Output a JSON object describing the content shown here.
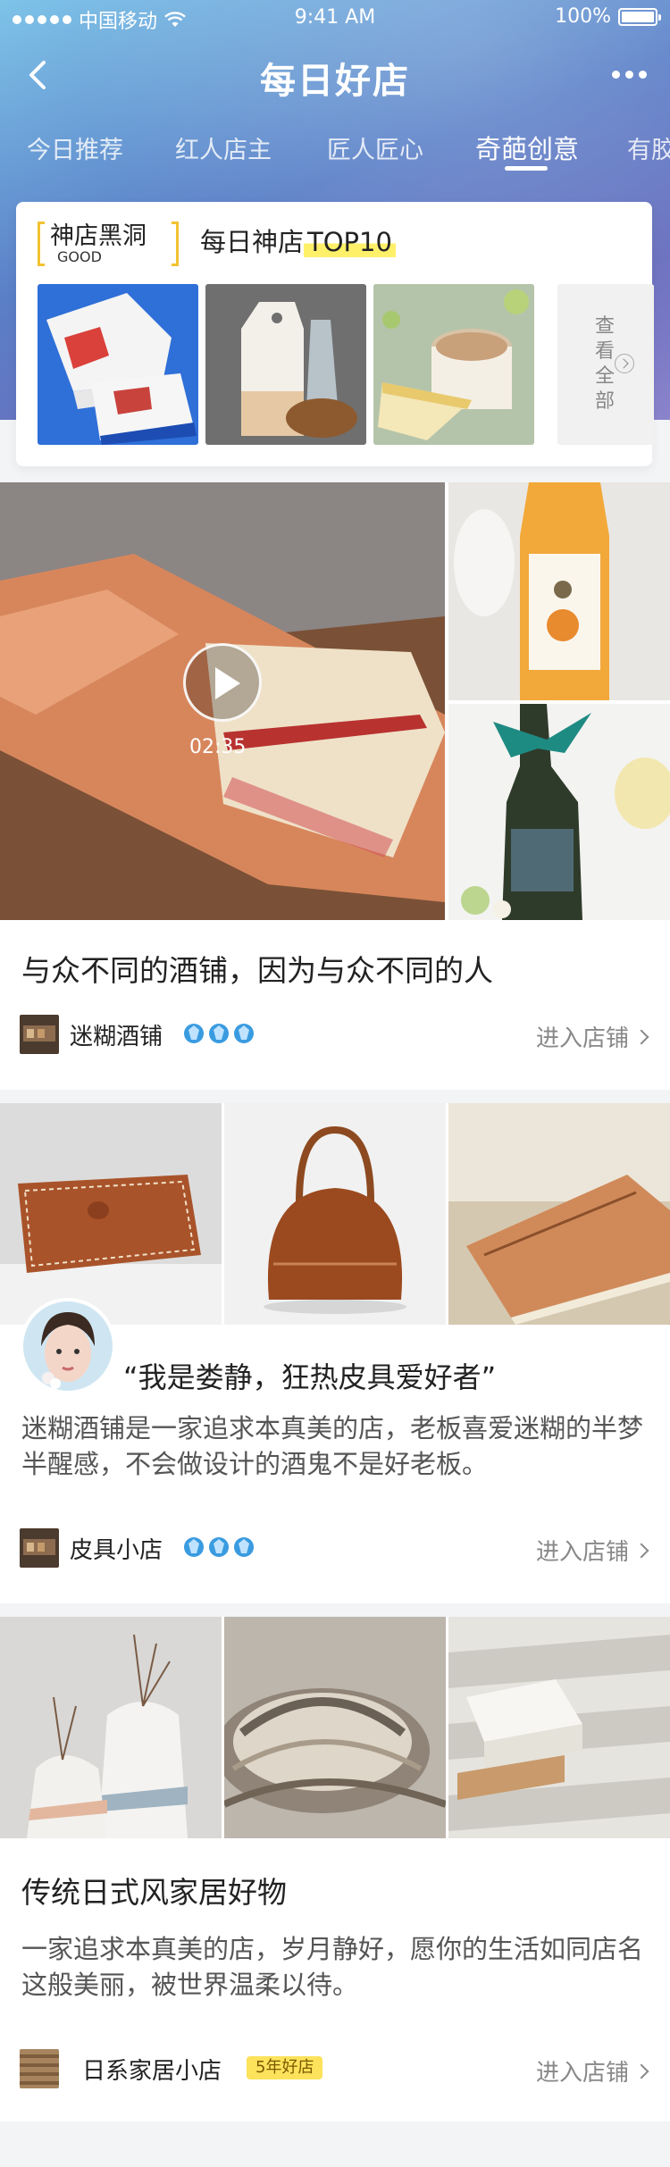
{
  "status_bar": {
    "carrier": "中国移动",
    "time": "9:41 AM",
    "battery": "100%"
  },
  "nav": {
    "title": "每日好店"
  },
  "tabs": [
    {
      "label": "今日推荐"
    },
    {
      "label": "红人店主"
    },
    {
      "label": "匠人匠心"
    },
    {
      "label": "奇葩创意",
      "active": true
    },
    {
      "label": "有胶"
    }
  ],
  "top_card": {
    "brand_cn": "神店黑洞",
    "brand_en": "GOOD",
    "title_prefix": "每日神店",
    "title_highlight": "TOP10",
    "view_all": "查看全部"
  },
  "cards": [
    {
      "duration": "02:35",
      "title": "与众不同的酒铺，因为与众不同的人",
      "shop_name": "迷糊酒铺",
      "crowns": 3,
      "enter": "进入店铺"
    },
    {
      "quote": "“我是娄静，狂热皮具爱好者”",
      "desc": "迷糊酒铺是一家追求本真美的店，老板喜爱迷糊的半梦半醒感，不会做设计的酒鬼不是好老板。",
      "shop_name": "皮具小店",
      "crowns": 3,
      "enter": "进入店铺"
    },
    {
      "title": "传统日式风家居好物",
      "desc": "一家追求本真美的店，岁月静好，愿你的生活如同店名这般美丽，被世界温柔以待。",
      "shop_name": "日系家居小店",
      "badge": "5年好店",
      "enter": "进入店铺"
    }
  ],
  "colors": {
    "accent_yellow": "#fde25b",
    "crown_blue": "#3a9be0",
    "header_gradient_start": "#7ec3e8",
    "header_gradient_end": "#8b84cc"
  }
}
